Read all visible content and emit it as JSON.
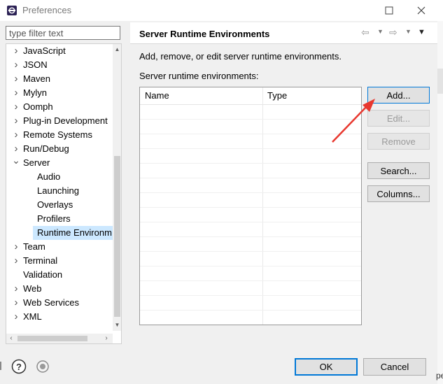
{
  "window": {
    "title": "Preferences"
  },
  "filter": {
    "placeholder": "type filter text"
  },
  "tree": [
    {
      "label": "JavaScript",
      "expander": "collapsed",
      "level": 0
    },
    {
      "label": "JSON",
      "expander": "collapsed",
      "level": 0
    },
    {
      "label": "Maven",
      "expander": "collapsed",
      "level": 0
    },
    {
      "label": "Mylyn",
      "expander": "collapsed",
      "level": 0
    },
    {
      "label": "Oomph",
      "expander": "collapsed",
      "level": 0
    },
    {
      "label": "Plug-in Development",
      "expander": "collapsed",
      "level": 0
    },
    {
      "label": "Remote Systems",
      "expander": "collapsed",
      "level": 0
    },
    {
      "label": "Run/Debug",
      "expander": "collapsed",
      "level": 0
    },
    {
      "label": "Server",
      "expander": "expanded",
      "level": 0
    },
    {
      "label": "Audio",
      "expander": "none",
      "level": 1
    },
    {
      "label": "Launching",
      "expander": "none",
      "level": 1
    },
    {
      "label": "Overlays",
      "expander": "none",
      "level": 1
    },
    {
      "label": "Profilers",
      "expander": "none",
      "level": 1
    },
    {
      "label": "Runtime Environm",
      "expander": "none",
      "level": 1,
      "selected": true
    },
    {
      "label": "Team",
      "expander": "collapsed",
      "level": 0
    },
    {
      "label": "Terminal",
      "expander": "collapsed",
      "level": 0
    },
    {
      "label": "Validation",
      "expander": "none",
      "level": 0
    },
    {
      "label": "Web",
      "expander": "collapsed",
      "level": 0
    },
    {
      "label": "Web Services",
      "expander": "collapsed",
      "level": 0
    },
    {
      "label": "XML",
      "expander": "collapsed",
      "level": 0
    }
  ],
  "page": {
    "title": "Server Runtime Environments",
    "description": "Add, remove, or edit server runtime environments.",
    "list_label": "Server runtime environments:",
    "columns": [
      "Name",
      "Type"
    ],
    "rows": []
  },
  "buttons": {
    "add": "Add...",
    "edit": "Edit...",
    "remove": "Remove",
    "search": "Search...",
    "columns": "Columns..."
  },
  "dialog": {
    "ok": "OK",
    "cancel": "Cancel"
  },
  "edge_text": "pe",
  "colors": {
    "selection": "#cce8ff",
    "focus": "#0078d7",
    "annotation_arrow": "#e8382f"
  }
}
